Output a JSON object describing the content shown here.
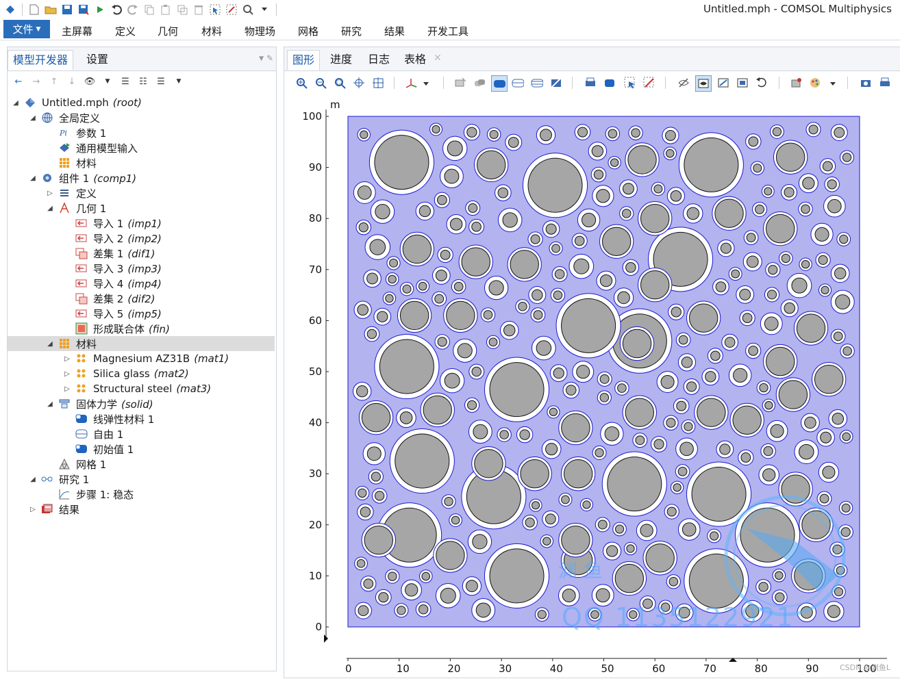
{
  "window": {
    "title": "Untitled.mph - COMSOL Multiphysics"
  },
  "ribbon": {
    "file_label": "文件",
    "tabs": [
      "主屏幕",
      "定义",
      "几何",
      "材料",
      "物理场",
      "网格",
      "研究",
      "结果",
      "开发工具"
    ]
  },
  "left_panel": {
    "tabs": [
      "模型开发器",
      "设置"
    ],
    "active_tab": "模型开发器"
  },
  "tree": [
    {
      "label": "Untitled.mph",
      "tag": "(root)",
      "level": 0,
      "expanded": true,
      "icon": "model-icon"
    },
    {
      "label": "全局定义",
      "tag": "",
      "level": 1,
      "expanded": true,
      "icon": "globe-icon"
    },
    {
      "label": "参数 1",
      "tag": "",
      "level": 2,
      "icon": "parameters-icon"
    },
    {
      "label": "通用模型输入",
      "tag": "",
      "level": 2,
      "icon": "model-input-icon"
    },
    {
      "label": "材料",
      "tag": "",
      "level": 2,
      "icon": "materials-icon"
    },
    {
      "label": "组件 1",
      "tag": "(comp1)",
      "level": 1,
      "expanded": true,
      "icon": "component-icon"
    },
    {
      "label": "定义",
      "tag": "",
      "level": 2,
      "collapsed": true,
      "icon": "definitions-icon"
    },
    {
      "label": "几何 1",
      "tag": "",
      "level": 2,
      "expanded": true,
      "icon": "geometry-icon"
    },
    {
      "label": "导入 1",
      "tag": "(imp1)",
      "level": 3,
      "icon": "import-icon"
    },
    {
      "label": "导入 2",
      "tag": "(imp2)",
      "level": 3,
      "icon": "import-icon"
    },
    {
      "label": "差集 1",
      "tag": "(dif1)",
      "level": 3,
      "icon": "difference-icon"
    },
    {
      "label": "导入 3",
      "tag": "(imp3)",
      "level": 3,
      "icon": "import-icon"
    },
    {
      "label": "导入 4",
      "tag": "(imp4)",
      "level": 3,
      "icon": "import-icon"
    },
    {
      "label": "差集 2",
      "tag": "(dif2)",
      "level": 3,
      "icon": "difference-icon"
    },
    {
      "label": "导入 5",
      "tag": "(imp5)",
      "level": 3,
      "icon": "import-icon"
    },
    {
      "label": "形成联合体",
      "tag": "(fin)",
      "level": 3,
      "icon": "form-union-icon"
    },
    {
      "label": "材料",
      "tag": "",
      "level": 2,
      "expanded": true,
      "selected": true,
      "icon": "materials-icon"
    },
    {
      "label": "Magnesium AZ31B",
      "tag": "(mat1)",
      "level": 3,
      "collapsed": true,
      "icon": "material-icon"
    },
    {
      "label": "Silica glass",
      "tag": "(mat2)",
      "level": 3,
      "collapsed": true,
      "icon": "material-icon"
    },
    {
      "label": "Structural steel",
      "tag": "(mat3)",
      "level": 3,
      "collapsed": true,
      "icon": "material-icon"
    },
    {
      "label": "固体力学",
      "tag": "(solid)",
      "level": 2,
      "expanded": true,
      "icon": "solid-mechanics-icon"
    },
    {
      "label": "线弹性材料 1",
      "tag": "",
      "level": 3,
      "icon": "linear-elastic-icon"
    },
    {
      "label": "自由 1",
      "tag": "",
      "level": 3,
      "icon": "free-icon"
    },
    {
      "label": "初始值 1",
      "tag": "",
      "level": 3,
      "icon": "initial-values-icon"
    },
    {
      "label": "网格 1",
      "tag": "",
      "level": 2,
      "icon": "mesh-icon"
    },
    {
      "label": "研究 1",
      "tag": "",
      "level": 1,
      "expanded": true,
      "icon": "study-icon"
    },
    {
      "label": "步骤 1: 稳态",
      "tag": "",
      "level": 2,
      "icon": "stationary-step-icon"
    },
    {
      "label": "结果",
      "tag": "",
      "level": 1,
      "collapsed": true,
      "icon": "results-icon"
    }
  ],
  "right_panel": {
    "tabs": [
      "图形",
      "进度",
      "日志",
      "表格"
    ],
    "active_tab": "图形"
  },
  "plot": {
    "unit_label": "m",
    "x_ticks": [
      "0",
      "10",
      "20",
      "30",
      "40",
      "50",
      "60",
      "70",
      "80",
      "90",
      "100"
    ],
    "y_ticks": [
      "0",
      "10",
      "20",
      "30",
      "40",
      "50",
      "60",
      "70",
      "80",
      "90",
      "100"
    ],
    "domain_color": "#b3b3f0",
    "inclusion_fill": "#a6a6a6",
    "coating_fill": "#ffffff",
    "boundary_color": "#1a1acc"
  },
  "watermark": {
    "line1": "渊 鱼",
    "line2": "QQ 1135122921"
  },
  "credit": "CSDN @渊鱼L"
}
